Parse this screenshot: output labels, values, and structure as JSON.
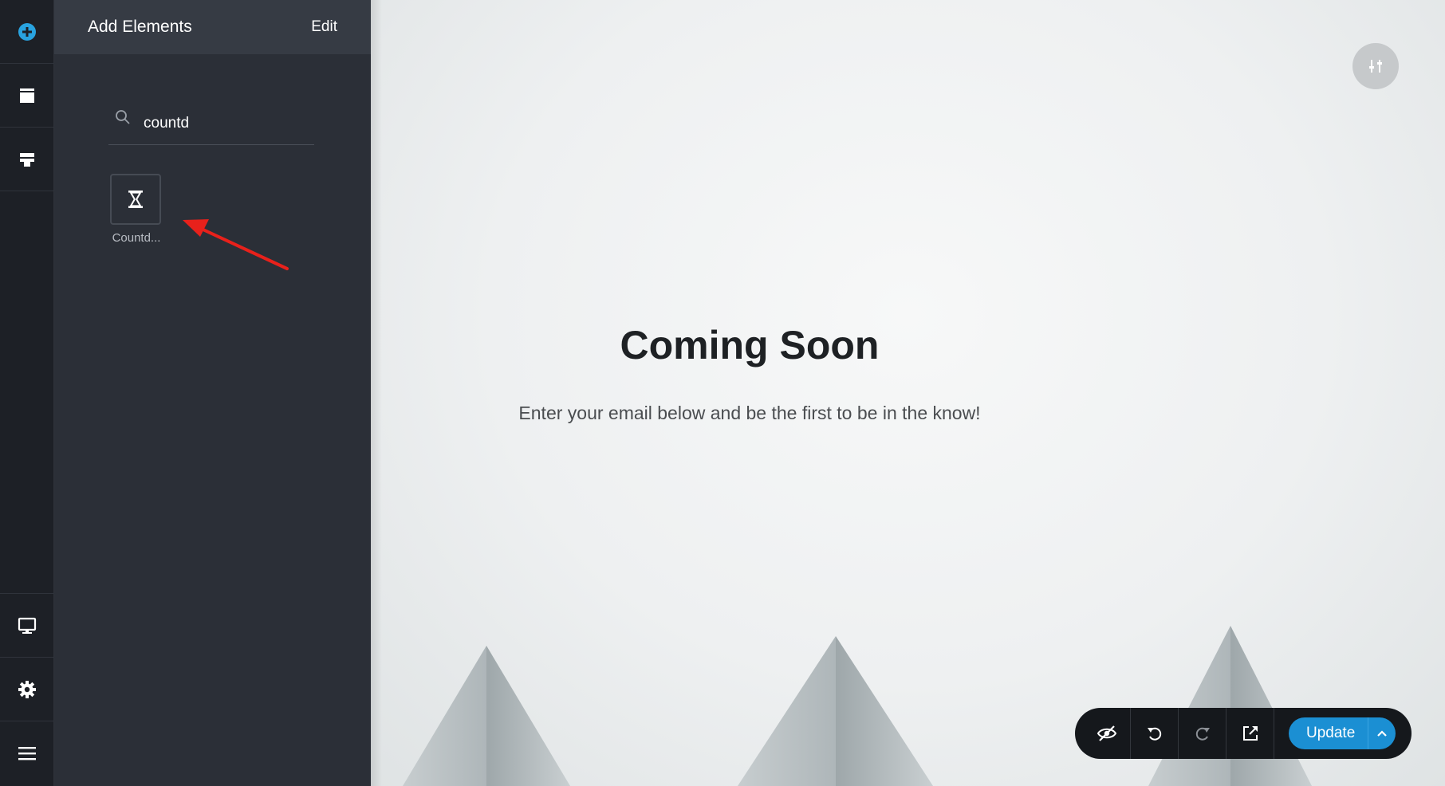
{
  "sidebar_rail": {
    "items": [
      {
        "icon": "add-circle-icon"
      },
      {
        "icon": "window-icon"
      },
      {
        "icon": "layout-icon"
      }
    ],
    "bottom_items": [
      {
        "icon": "monitor-icon"
      },
      {
        "icon": "gear-icon"
      },
      {
        "icon": "hamburger-menu-icon"
      }
    ],
    "accent_color": "#29a3e0"
  },
  "panel": {
    "title": "Add Elements",
    "edit_label": "Edit",
    "search": {
      "value": "countd",
      "placeholder": ""
    },
    "results": [
      {
        "label": "Countd...",
        "icon": "hourglass-icon"
      }
    ]
  },
  "annotation": {
    "color": "#e8211b",
    "icon": "red-arrow"
  },
  "canvas": {
    "heading": "Coming Soon",
    "subtitle": "Enter your email below and be the first to be in the know!"
  },
  "toolbar": {
    "buttons": [
      {
        "icon": "eye-slash-icon"
      },
      {
        "icon": "undo-icon"
      },
      {
        "icon": "redo-icon"
      },
      {
        "icon": "external-link-icon"
      }
    ],
    "update_label": "Update",
    "update_color": "#1b8fd3"
  }
}
